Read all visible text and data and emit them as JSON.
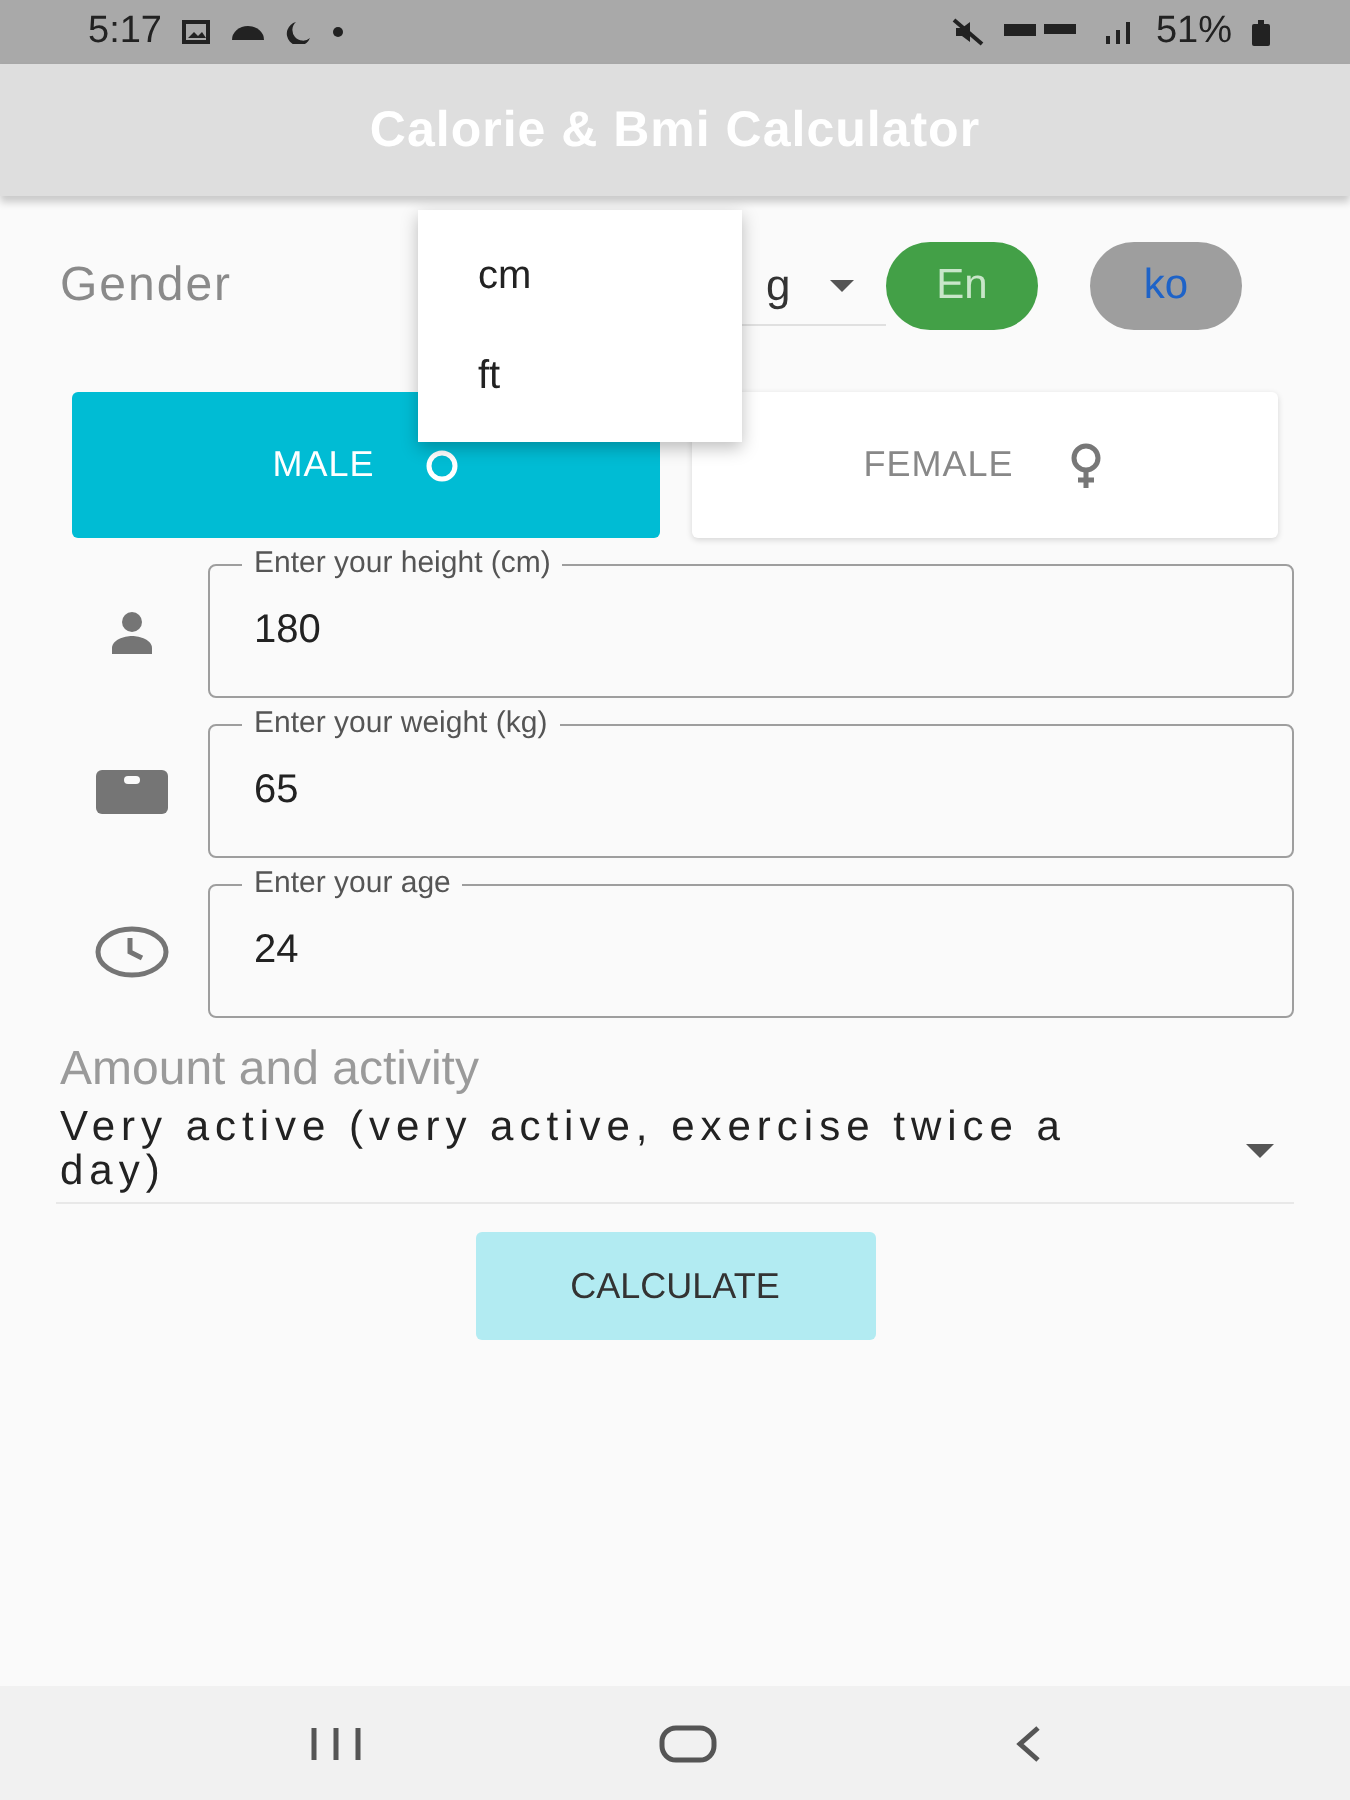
{
  "status_bar": {
    "time": "5:17",
    "battery": "51%"
  },
  "app_bar": {
    "title": "Calorie & Bmi Calculator"
  },
  "gender_row": {
    "label": "Gender",
    "unit_select": {
      "value": "g"
    },
    "languages": [
      {
        "label": "En",
        "selected": true
      },
      {
        "label": "ko",
        "selected": false
      }
    ]
  },
  "unit_menu": {
    "items": [
      "cm",
      "ft"
    ]
  },
  "gender_buttons": [
    {
      "label": "MALE",
      "selected": true
    },
    {
      "label": "FEMALE",
      "selected": false
    }
  ],
  "fields": [
    {
      "label": "Enter your height (cm)",
      "value": "180"
    },
    {
      "label": "Enter your weight (kg)",
      "value": "65"
    },
    {
      "label": "Enter your age",
      "value": "24"
    }
  ],
  "activity": {
    "label": "Amount and activity",
    "value": "Very active (very active, exercise twice a day)"
  },
  "calculate_button": {
    "label": "CALCULATE"
  }
}
